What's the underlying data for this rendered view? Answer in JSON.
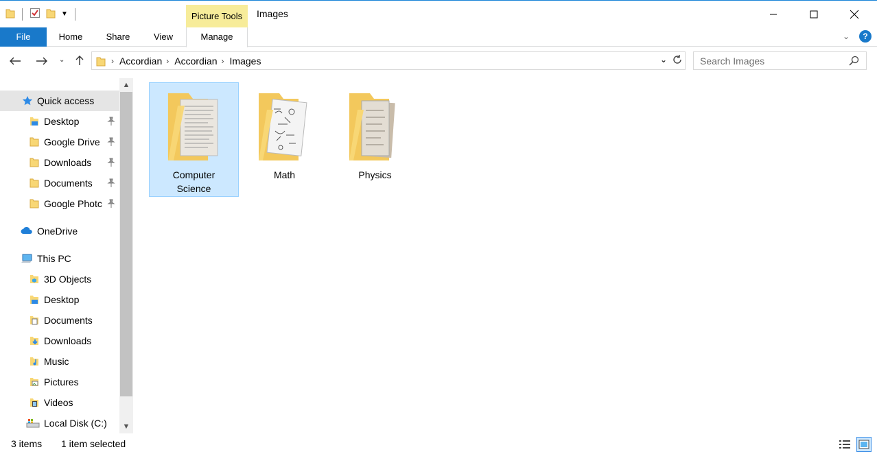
{
  "window": {
    "title": "Images",
    "context_tab_group": "Picture Tools"
  },
  "ribbon": {
    "tabs": [
      {
        "label": "File"
      },
      {
        "label": "Home"
      },
      {
        "label": "Share"
      },
      {
        "label": "View"
      },
      {
        "label": "Manage"
      }
    ]
  },
  "address": {
    "breadcrumbs": [
      "Accordian",
      "Accordian",
      "Images"
    ]
  },
  "search": {
    "placeholder": "Search Images"
  },
  "sidebar": {
    "quick_access": {
      "label": "Quick access"
    },
    "pinned": [
      {
        "label": "Desktop"
      },
      {
        "label": "Google Drive"
      },
      {
        "label": "Downloads"
      },
      {
        "label": "Documents"
      },
      {
        "label": "Google Photc"
      }
    ],
    "onedrive": {
      "label": "OneDrive"
    },
    "this_pc": {
      "label": "This PC"
    },
    "pc_items": [
      {
        "label": "3D Objects"
      },
      {
        "label": "Desktop"
      },
      {
        "label": "Documents"
      },
      {
        "label": "Downloads"
      },
      {
        "label": "Music"
      },
      {
        "label": "Pictures"
      },
      {
        "label": "Videos"
      },
      {
        "label": "Local Disk (C:)"
      }
    ]
  },
  "folders": [
    {
      "label": "Computer Science",
      "selected": true
    },
    {
      "label": "Math",
      "selected": false
    },
    {
      "label": "Physics",
      "selected": false
    }
  ],
  "status": {
    "item_count": "3 items",
    "selection": "1 item selected"
  },
  "colors": {
    "accent": "#1979ca",
    "picture_tools": "#f7ec9a",
    "selection": "#cce8ff",
    "folder": "#f8d775"
  }
}
